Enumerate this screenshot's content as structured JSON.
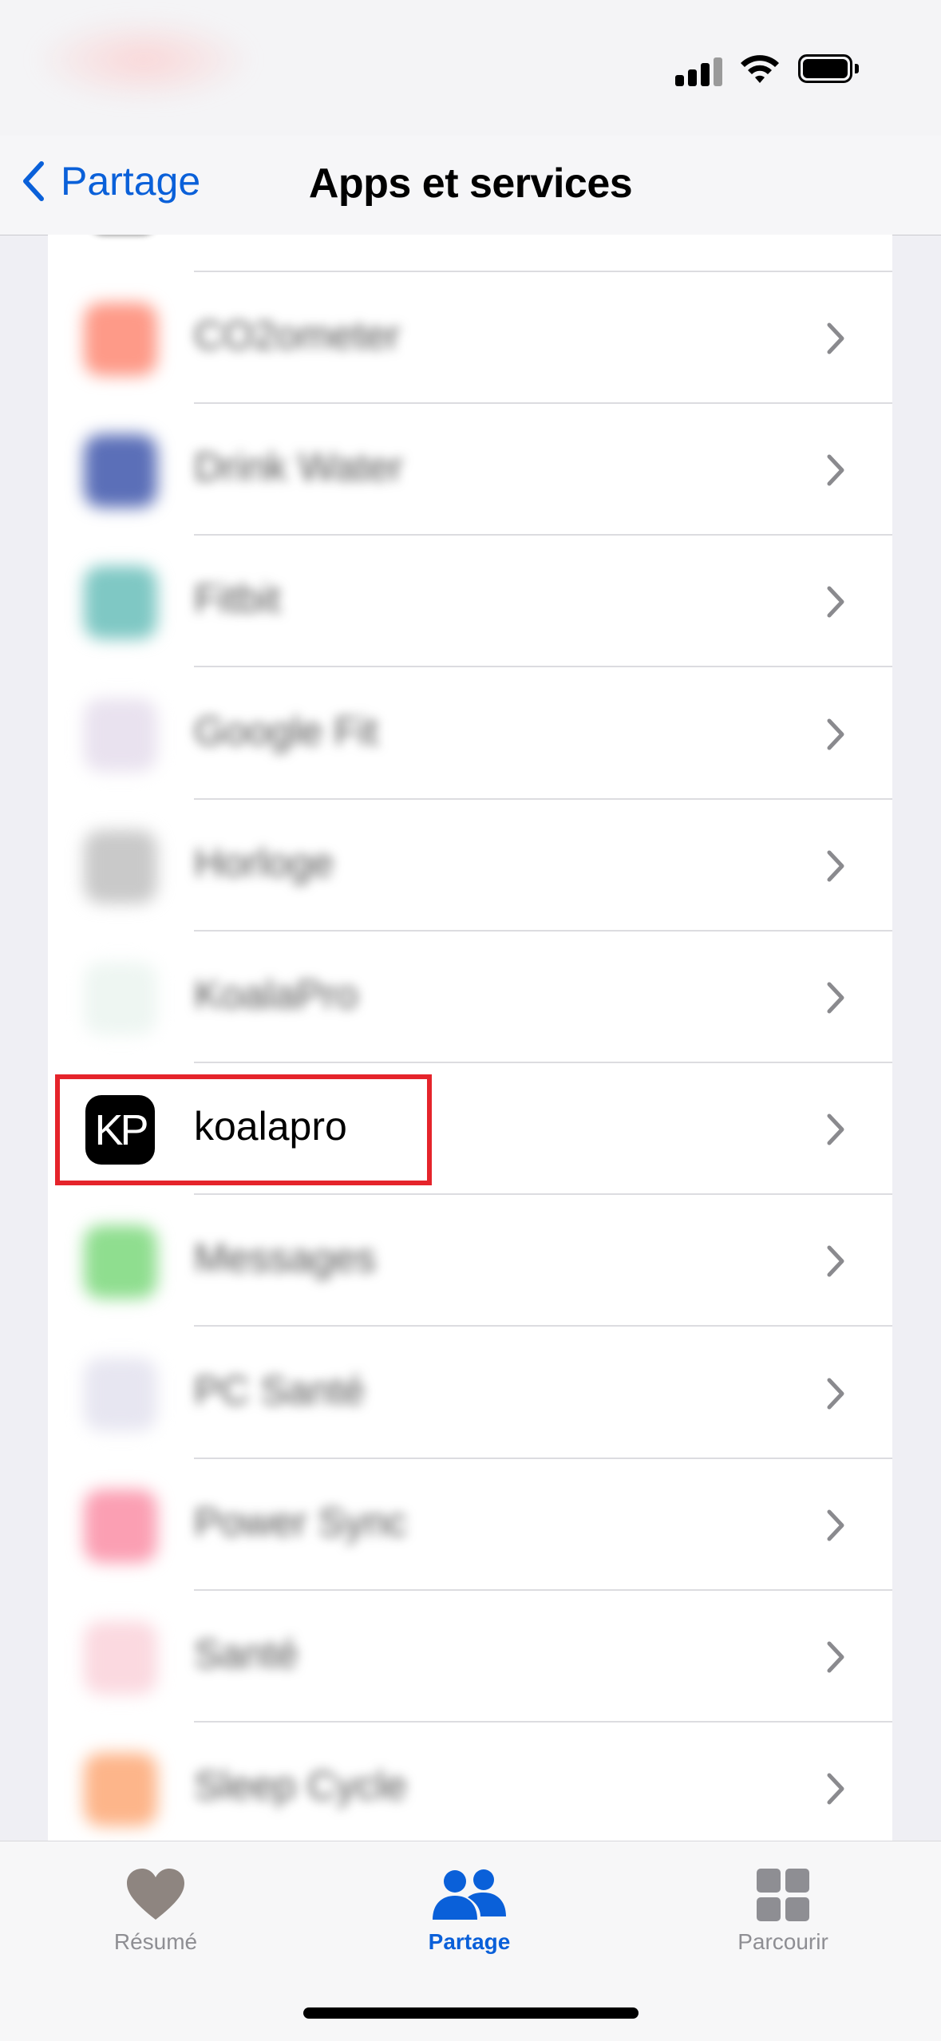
{
  "status_bar": {
    "signal_icon": "cellular-signal-icon",
    "wifi_icon": "wifi-icon",
    "battery_icon": "battery-icon"
  },
  "nav": {
    "back_label": "Partage",
    "title": "Apps et services"
  },
  "list": {
    "rows": [
      {
        "label": "CO2ometer",
        "icon_color": "#fe9a88",
        "blurred": true
      },
      {
        "label": "Drink Water",
        "icon_color": "#5b6fb8",
        "blurred": true
      },
      {
        "label": "Fitbit",
        "icon_color": "#7fc8c4",
        "blurred": true
      },
      {
        "label": "Google Fit",
        "icon_color": "#e9e2ef",
        "blurred": true
      },
      {
        "label": "Horloge",
        "icon_color": "#c9c9c9",
        "blurred": true
      },
      {
        "label": "KoalaPro",
        "icon_color": "#eef6f2",
        "blurred": true
      },
      {
        "label": "koalapro",
        "icon_text": "KP",
        "icon_color": "#000000",
        "blurred": false
      },
      {
        "label": "Messages",
        "icon_color": "#8fde8f",
        "blurred": true
      },
      {
        "label": "PC Santé",
        "icon_color": "#e7e6f1",
        "blurred": true
      },
      {
        "label": "Power Sync",
        "icon_color": "#fb9fb3",
        "blurred": true
      },
      {
        "label": "Santé",
        "icon_color": "#fbd9e0",
        "blurred": true
      },
      {
        "label": "Sleep Cycle",
        "icon_color": "#fdb58a",
        "blurred": true
      }
    ]
  },
  "tab_bar": {
    "tabs": [
      {
        "label": "Résumé",
        "icon": "heart-icon",
        "active": false
      },
      {
        "label": "Partage",
        "icon": "people-icon",
        "active": true
      },
      {
        "label": "Parcourir",
        "icon": "grid-icon",
        "active": false
      }
    ]
  },
  "colors": {
    "accent": "#0a60d9",
    "highlight_box": "#e5242b",
    "inactive_tab": "#8e8e93"
  }
}
